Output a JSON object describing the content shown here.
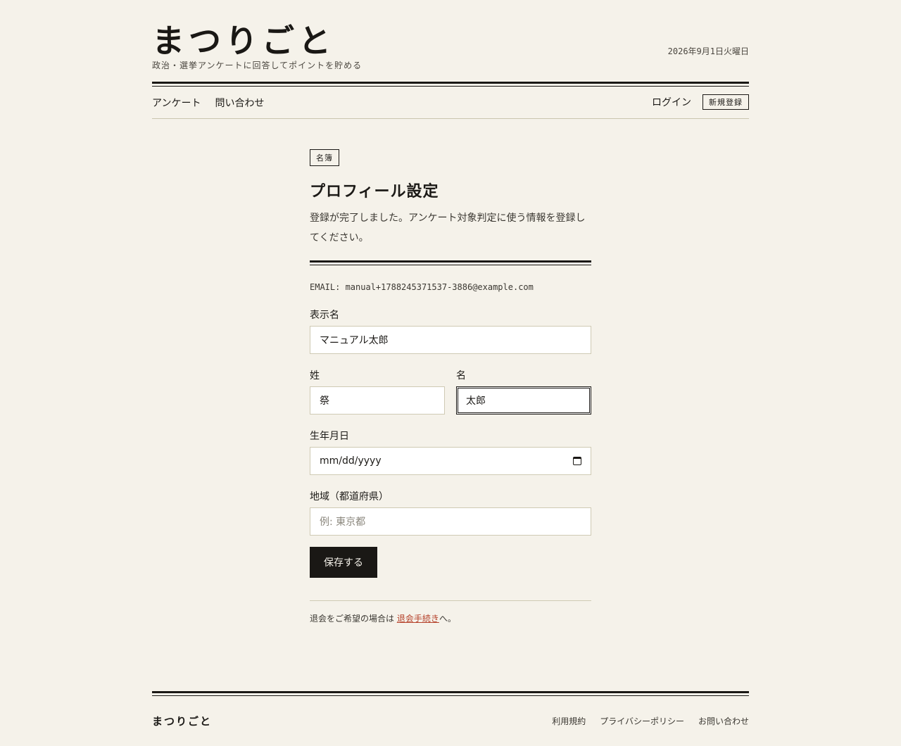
{
  "header": {
    "logo": "まつりごと",
    "tagline": "政治・選挙アンケートに回答してポイントを貯める",
    "date": "2026年9月1日火曜日"
  },
  "nav": {
    "left": [
      "アンケート",
      "問い合わせ"
    ],
    "login": "ログイン",
    "register": "新規登録"
  },
  "main": {
    "tag": "名簿",
    "title": "プロフィール設定",
    "description": "登録が完了しました。アンケート対象判定に使う情報を登録してください。",
    "email": "EMAIL: manual+1788245371537-3886@example.com",
    "fields": {
      "display_name": {
        "label": "表示名",
        "value": "マニュアル太郎"
      },
      "last_name": {
        "label": "姓",
        "value": "祭"
      },
      "first_name": {
        "label": "名",
        "value": "太郎"
      },
      "birthdate": {
        "label": "生年月日",
        "placeholder": "mm/dd/yyyy"
      },
      "region": {
        "label": "地域（都道府県）",
        "placeholder": "例: 東京都"
      }
    },
    "save_label": "保存する",
    "withdraw_prefix": "退会をご希望の場合は ",
    "withdraw_link": "退会手続き",
    "withdraw_suffix": "へ。"
  },
  "footer": {
    "logo": "まつりごと",
    "links": [
      "利用規約",
      "プライバシーポリシー",
      "お問い合わせ"
    ]
  }
}
